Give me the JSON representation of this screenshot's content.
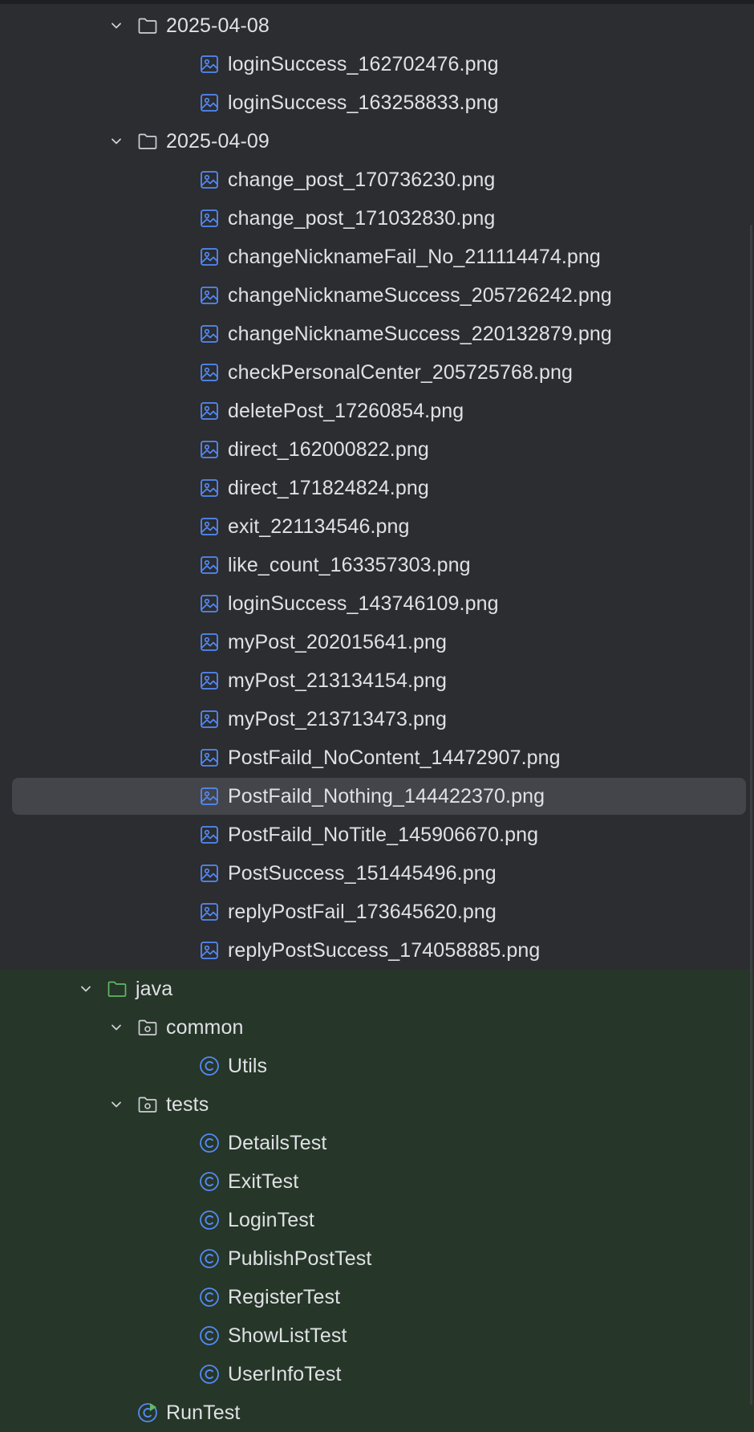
{
  "tree": [
    {
      "kind": "folder",
      "label": "2025-04-08",
      "level": 0,
      "expanded": true,
      "section": "dark"
    },
    {
      "kind": "image",
      "label": "loginSuccess_162702476.png",
      "level": 1,
      "section": "dark"
    },
    {
      "kind": "image",
      "label": "loginSuccess_163258833.png",
      "level": 1,
      "section": "dark"
    },
    {
      "kind": "folder",
      "label": "2025-04-09",
      "level": 0,
      "expanded": true,
      "section": "dark"
    },
    {
      "kind": "image",
      "label": "change_post_170736230.png",
      "level": 1,
      "section": "dark"
    },
    {
      "kind": "image",
      "label": "change_post_171032830.png",
      "level": 1,
      "section": "dark"
    },
    {
      "kind": "image",
      "label": "changeNicknameFail_No_211114474.png",
      "level": 1,
      "section": "dark"
    },
    {
      "kind": "image",
      "label": "changeNicknameSuccess_205726242.png",
      "level": 1,
      "section": "dark"
    },
    {
      "kind": "image",
      "label": "changeNicknameSuccess_220132879.png",
      "level": 1,
      "section": "dark"
    },
    {
      "kind": "image",
      "label": "checkPersonalCenter_205725768.png",
      "level": 1,
      "section": "dark"
    },
    {
      "kind": "image",
      "label": "deletePost_17260854.png",
      "level": 1,
      "section": "dark"
    },
    {
      "kind": "image",
      "label": "direct_162000822.png",
      "level": 1,
      "section": "dark"
    },
    {
      "kind": "image",
      "label": "direct_171824824.png",
      "level": 1,
      "section": "dark"
    },
    {
      "kind": "image",
      "label": "exit_221134546.png",
      "level": 1,
      "section": "dark"
    },
    {
      "kind": "image",
      "label": "like_count_163357303.png",
      "level": 1,
      "section": "dark"
    },
    {
      "kind": "image",
      "label": "loginSuccess_143746109.png",
      "level": 1,
      "section": "dark"
    },
    {
      "kind": "image",
      "label": "myPost_202015641.png",
      "level": 1,
      "section": "dark"
    },
    {
      "kind": "image",
      "label": "myPost_213134154.png",
      "level": 1,
      "section": "dark"
    },
    {
      "kind": "image",
      "label": "myPost_213713473.png",
      "level": 1,
      "section": "dark"
    },
    {
      "kind": "image",
      "label": "PostFaild_NoContent_14472907.png",
      "level": 1,
      "section": "dark"
    },
    {
      "kind": "image",
      "label": "PostFaild_Nothing_144422370.png",
      "level": 1,
      "section": "dark",
      "selected": true
    },
    {
      "kind": "image",
      "label": "PostFaild_NoTitle_145906670.png",
      "level": 1,
      "section": "dark"
    },
    {
      "kind": "image",
      "label": "PostSuccess_151445496.png",
      "level": 1,
      "section": "dark"
    },
    {
      "kind": "image",
      "label": "replyPostFail_173645620.png",
      "level": 1,
      "section": "dark"
    },
    {
      "kind": "image",
      "label": "replyPostSuccess_174058885.png",
      "level": 1,
      "section": "dark"
    },
    {
      "kind": "source-folder",
      "label": "java",
      "level": -1,
      "expanded": true,
      "section": "green"
    },
    {
      "kind": "package",
      "label": "common",
      "level": 0,
      "expanded": true,
      "section": "green"
    },
    {
      "kind": "class",
      "label": "Utils",
      "level": 1,
      "section": "green"
    },
    {
      "kind": "package",
      "label": "tests",
      "level": 0,
      "expanded": true,
      "section": "green"
    },
    {
      "kind": "class",
      "label": "DetailsTest",
      "level": 1,
      "section": "green"
    },
    {
      "kind": "class",
      "label": "ExitTest",
      "level": 1,
      "section": "green"
    },
    {
      "kind": "class",
      "label": "LoginTest",
      "level": 1,
      "section": "green"
    },
    {
      "kind": "class",
      "label": "PublishPostTest",
      "level": 1,
      "section": "green"
    },
    {
      "kind": "class",
      "label": "RegisterTest",
      "level": 1,
      "section": "green"
    },
    {
      "kind": "class",
      "label": "ShowListTest",
      "level": 1,
      "section": "green"
    },
    {
      "kind": "class",
      "label": "UserInfoTest",
      "level": 1,
      "section": "green"
    },
    {
      "kind": "run-class",
      "label": "RunTest",
      "level": 0,
      "section": "green"
    }
  ],
  "colors": {
    "background": "#2b2d30",
    "test_source_bg": "#263628",
    "selection": "#43454a",
    "text": "#dfe1e5",
    "image_icon": "#548af7",
    "class_icon": "#548af7",
    "source_folder_icon": "#5fb865",
    "folder_icon": "#ced0d6"
  }
}
